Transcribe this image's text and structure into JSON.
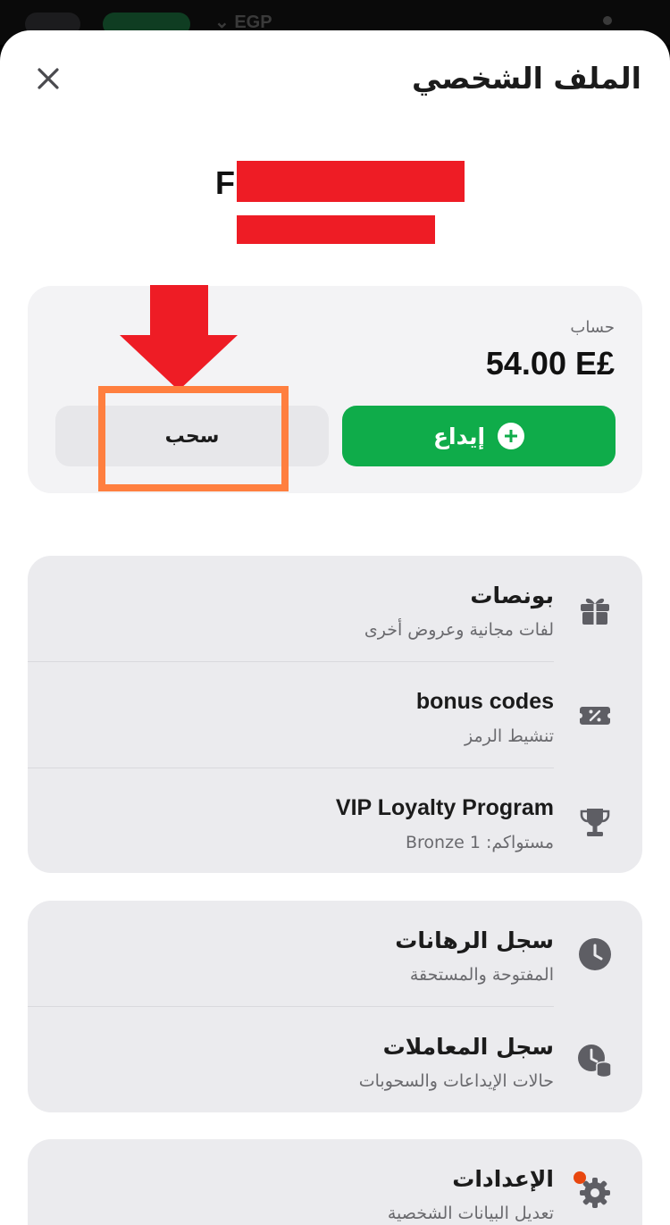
{
  "statusbar": {
    "currency": "EGP"
  },
  "header": {
    "title": "الملف الشخصي"
  },
  "user": {
    "name_initial": "F"
  },
  "account": {
    "label": "حساب",
    "balance": "54.00 E£",
    "deposit_label": "إيداع",
    "withdraw_label": "سحب"
  },
  "menu": {
    "bonuses": {
      "title": "بونصات",
      "subtitle": "لفات مجانية وعروض أخرى"
    },
    "bonus_codes": {
      "title": "bonus codes",
      "subtitle": "تنشيط الرمز"
    },
    "vip": {
      "title": "VIP Loyalty Program",
      "subtitle": "مستواكم: 1 Bronze"
    },
    "bet_history": {
      "title": "سجل الرهانات",
      "subtitle": "المفتوحة والمستحقة"
    },
    "transactions": {
      "title": "سجل المعاملات",
      "subtitle": "حالات الإيداعات والسحوبات"
    },
    "settings": {
      "title": "الإعدادات",
      "subtitle": "تعديل البيانات الشخصية"
    }
  },
  "colors": {
    "deposit_green": "#0fac4a",
    "annotation_red": "#ee1c25",
    "annotation_orange": "#ff7f3f",
    "notification": "#e8470f"
  }
}
